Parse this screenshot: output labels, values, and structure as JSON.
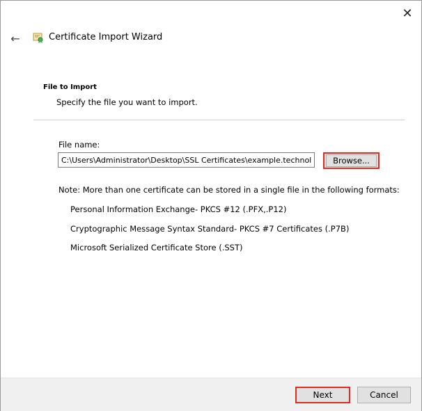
{
  "window": {
    "title": "Certificate Import Wizard",
    "close_glyph": "✕",
    "back_glyph": "←"
  },
  "section": {
    "title": "File to Import",
    "description": "Specify the file you want to import."
  },
  "file": {
    "label": "File name:",
    "value": "C:\\Users\\Administrator\\Desktop\\SSL Certificates\\example.technolo",
    "browse_label": "Browse..."
  },
  "note": "Note:  More than one certificate can be stored in a single file in the following formats:",
  "formats": [
    "Personal Information Exchange- PKCS #12 (.PFX,.P12)",
    "Cryptographic Message Syntax Standard- PKCS #7 Certificates (.P7B)",
    "Microsoft Serialized Certificate Store (.SST)"
  ],
  "footer": {
    "next_label": "Next",
    "cancel_label": "Cancel"
  },
  "colors": {
    "highlight": "#e02b20",
    "footer_bg": "#f0f0f0",
    "button_bg": "#e1e1e1"
  },
  "icons": {
    "title_icon": "certificate-icon",
    "back": "back-arrow-icon",
    "close": "close-icon"
  }
}
